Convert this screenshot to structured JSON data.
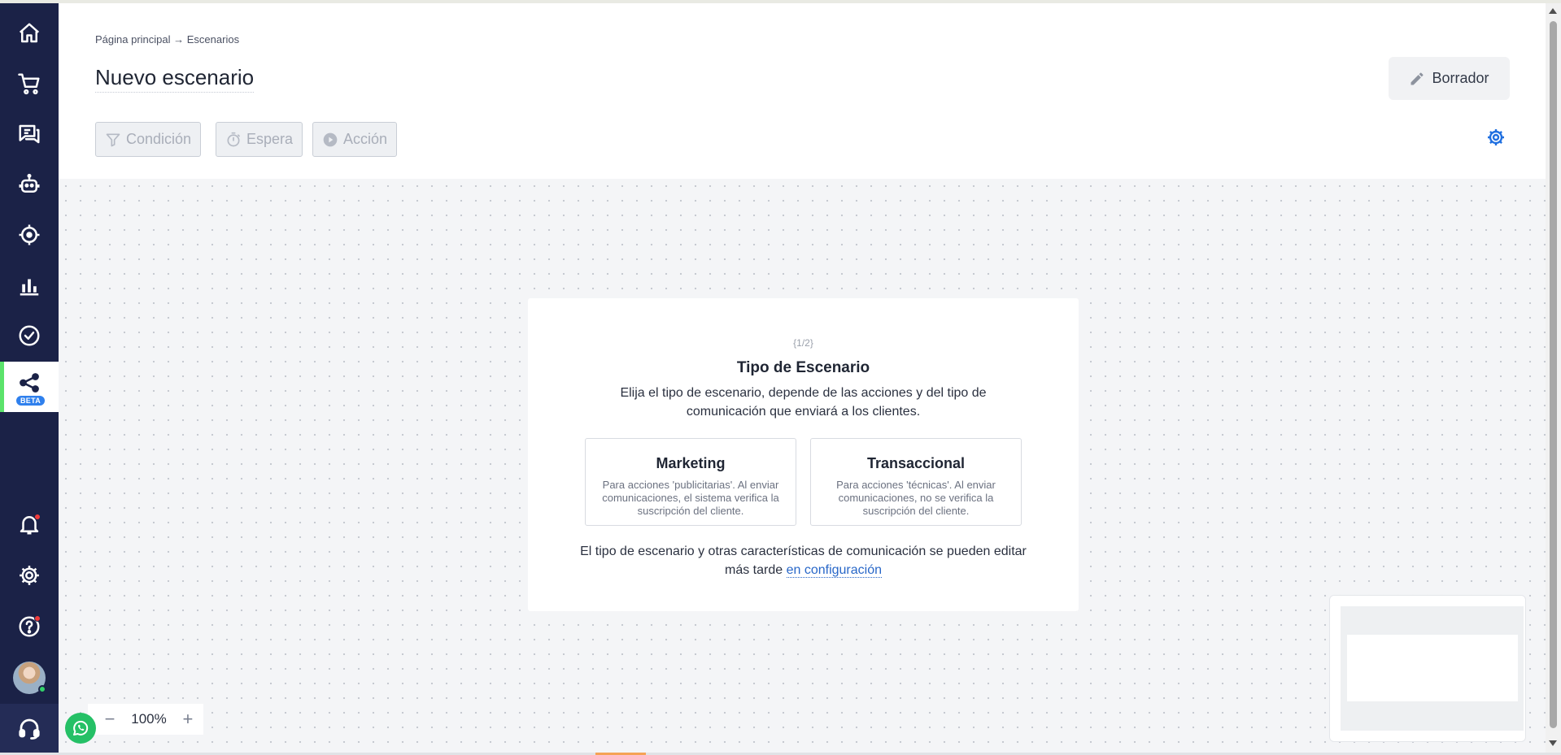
{
  "breadcrumb": {
    "home": "Página principal",
    "separator": "→",
    "current": "Escenarios"
  },
  "page_title": "Nuevo escenario",
  "draft_button": {
    "label": "Borrador",
    "icon": "pencil-icon"
  },
  "toolbar": {
    "condition_label": "Condición",
    "wait_label": "Espera",
    "action_label": "Acción"
  },
  "sidebar": {
    "items": [
      {
        "icon": "home-icon"
      },
      {
        "icon": "cart-icon"
      },
      {
        "icon": "chat-icon"
      },
      {
        "icon": "bot-icon"
      },
      {
        "icon": "target-icon"
      },
      {
        "icon": "bar-chart-icon"
      },
      {
        "icon": "check-circle-icon"
      },
      {
        "icon": "share-nodes-icon",
        "badge": "BETA",
        "active": true
      }
    ],
    "bottom": [
      {
        "icon": "bell-icon"
      },
      {
        "icon": "gear-icon"
      },
      {
        "icon": "help-icon"
      },
      {
        "icon": "avatar"
      },
      {
        "icon": "headset-icon"
      }
    ]
  },
  "modal": {
    "step": "{1/2}",
    "title": "Tipo de Escenario",
    "description": "Elija el tipo de escenario, depende de las acciones y del tipo de comunicación que enviará a los clientes.",
    "cards": [
      {
        "title": "Marketing",
        "description": "Para acciones 'publicitarias'. Al enviar comunicaciones, el sistema verifica la suscripción del cliente."
      },
      {
        "title": "Transaccional",
        "description": "Para acciones 'técnicas'. Al enviar comunicaciones, no se verifica la suscripción del cliente."
      }
    ],
    "footer_text": "El tipo de escenario y otras características de comunicación se pueden editar más tarde",
    "footer_link": "en configuración"
  },
  "zoom": {
    "level": "100%",
    "minus": "−",
    "plus": "+"
  },
  "colors": {
    "sidebar": "#1b2247",
    "active_indicator": "#5be36b",
    "link": "#2867c8",
    "accent_gear": "#1f6fe0",
    "whatsapp": "#25c066"
  }
}
